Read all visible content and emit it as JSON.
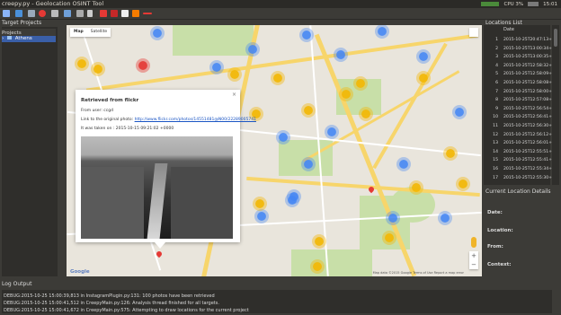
{
  "window": {
    "title": "creepy.py - Geolocation OSINT Tool"
  },
  "tray": {
    "cpu": "CPU 3%",
    "clock": "15:01"
  },
  "docks": {
    "projects_title": "Target Projects",
    "locations_title": "Locations List",
    "details_title": "Current Location Details",
    "log_title": "Log Output"
  },
  "projects": {
    "header": "Projects",
    "items": [
      {
        "label": "Athens"
      }
    ]
  },
  "map": {
    "type_buttons": [
      "Map",
      "Satellite"
    ],
    "google": "Google",
    "attribution": "Map data ©2015 Google   Terms of Use   Report a map error"
  },
  "popup": {
    "title": "Retrieved from flickr",
    "from_user": "From user: ccgd",
    "link_prefix": "Link to the original photo: ",
    "link": "http://www.flickr.com/photos/14551481@N00/22289005741",
    "taken": "It was taken on : 2015-10-15 09:21:02 +0000"
  },
  "locations": {
    "header": "Date",
    "rows": [
      {
        "n": "1",
        "date": "2015-10-25T20:47:13+00"
      },
      {
        "n": "2",
        "date": "2015-10-25T13:00:34+00"
      },
      {
        "n": "3",
        "date": "2015-10-25T13:00:35+00"
      },
      {
        "n": "4",
        "date": "2015-10-25T12:58:32+00"
      },
      {
        "n": "5",
        "date": "2015-10-25T12:58:09+00"
      },
      {
        "n": "6",
        "date": "2015-10-25T12:58:08+00"
      },
      {
        "n": "7",
        "date": "2015-10-25T12:58:00+00"
      },
      {
        "n": "8",
        "date": "2015-10-25T12:57:08+00"
      },
      {
        "n": "9",
        "date": "2015-10-25T12:56:54+00"
      },
      {
        "n": "10",
        "date": "2015-10-25T12:56:41+00"
      },
      {
        "n": "11",
        "date": "2015-10-25T12:56:30+00"
      },
      {
        "n": "12",
        "date": "2015-10-25T12:56:12+00"
      },
      {
        "n": "13",
        "date": "2015-10-25T12:56:01+00"
      },
      {
        "n": "14",
        "date": "2015-10-25T12:55:51+00"
      },
      {
        "n": "15",
        "date": "2015-10-25T12:55:41+00"
      },
      {
        "n": "16",
        "date": "2015-10-25T12:55:34+00"
      },
      {
        "n": "17",
        "date": "2015-10-25T12:55:30+00"
      }
    ]
  },
  "details": {
    "date": "Date:",
    "location": "Location:",
    "from": "From:",
    "context": "Context:"
  },
  "log": {
    "lines": [
      "DEBUG:2015-10-25 15:00:39,813  in InstagramPlugin.py:131: 100 photos have been retrieved",
      "DEBUG:2015-10-25 15:00:41,512  in CreepyMain.py:126: Analysis thread finished for all targets.",
      "DEBUG:2015-10-25 15:00:41,672  in CreepyMain.py:575: Attempting to draw locations for the current project"
    ]
  },
  "colors": {
    "accent": "#3a5fa8",
    "cluster_blue": "#4285f4",
    "cluster_yellow": "#f2b705",
    "pin": "#e53935"
  }
}
